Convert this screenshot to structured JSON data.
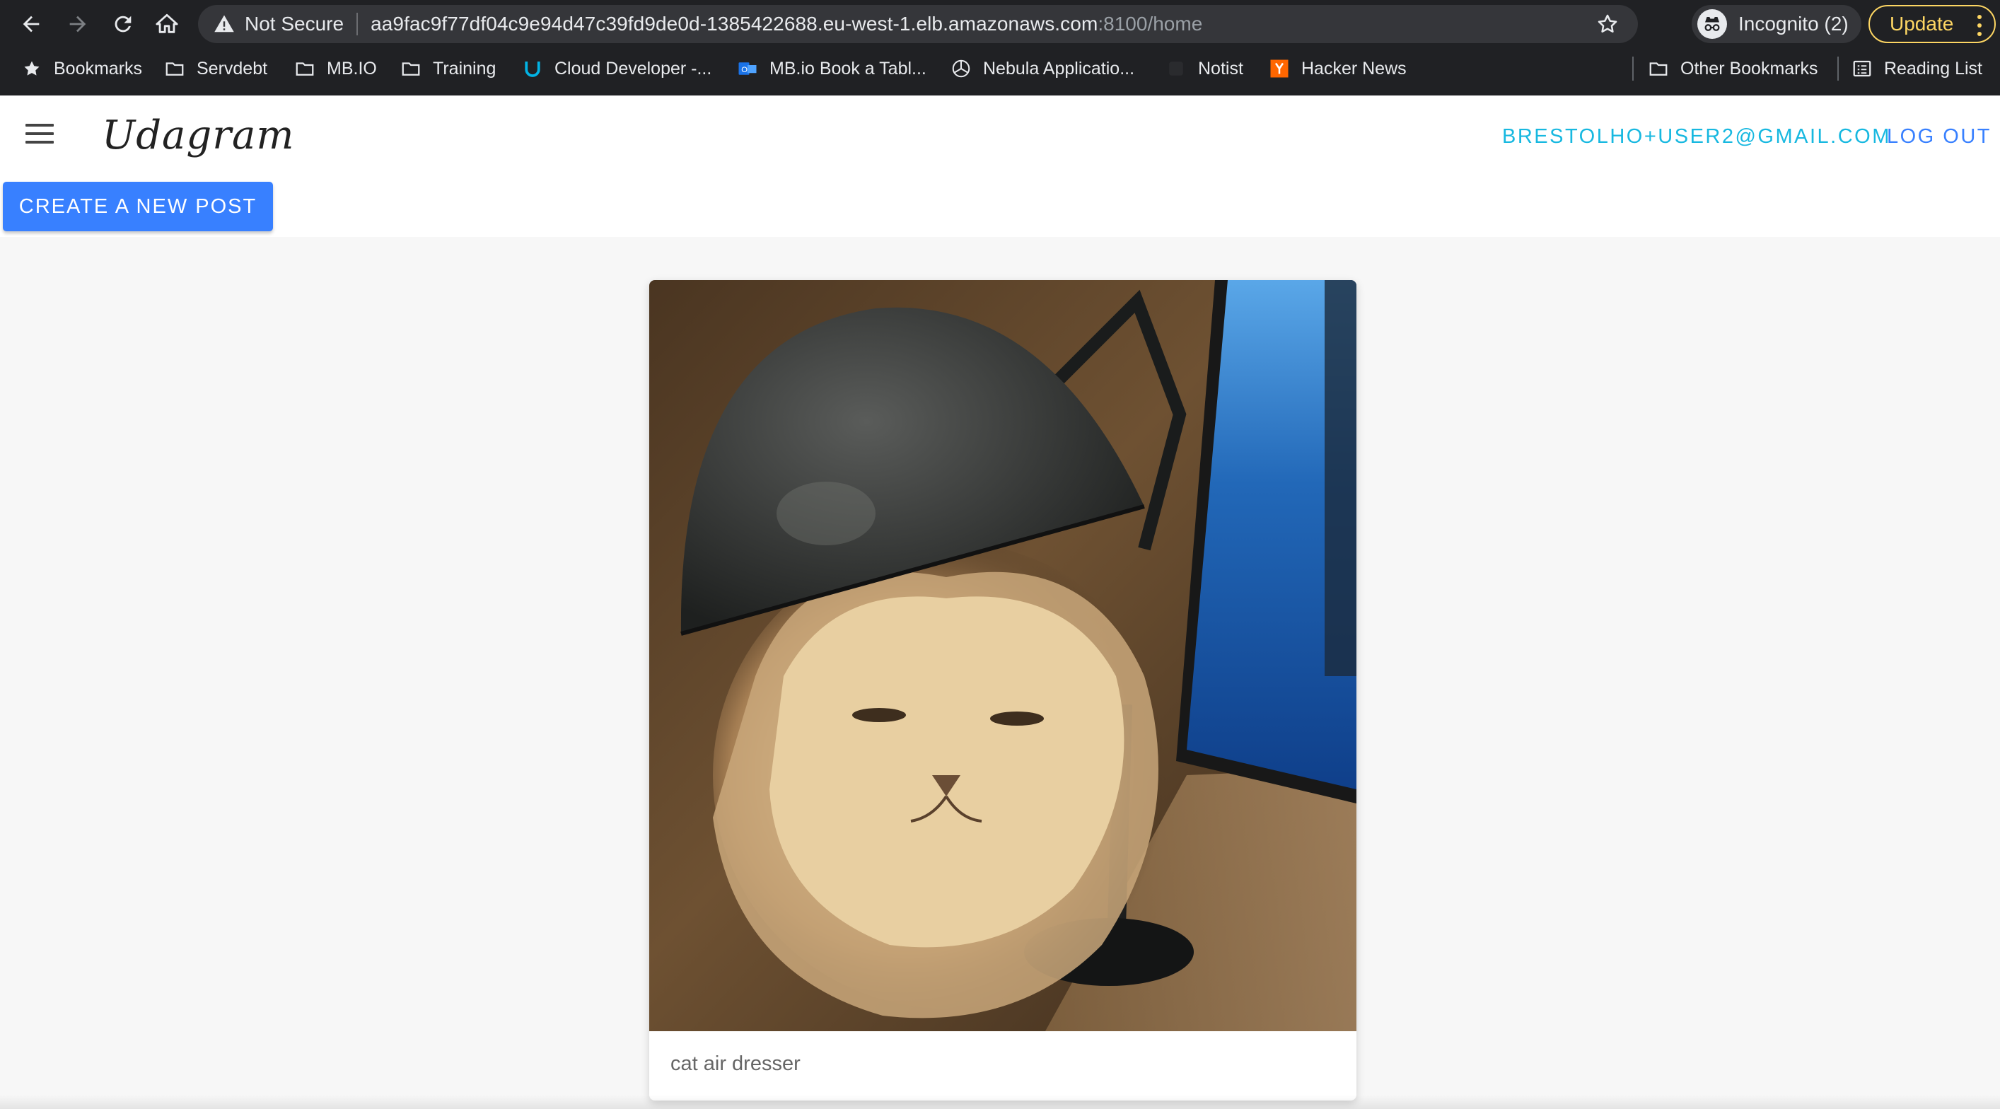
{
  "browser": {
    "security_label": "Not Secure",
    "url_host": "aa9fac9f77df04c9e94d47c39fd9de0d-1385422688.eu-west-1.elb.amazonaws.com",
    "url_rest": ":8100/home",
    "incognito_label": "Incognito (2)",
    "update_label": "Update",
    "bookmarks": {
      "b0": "Bookmarks",
      "b1": "Servdebt",
      "b2": "MB.IO",
      "b3": "Training",
      "b4": "Cloud Developer -...",
      "b5": "MB.io Book a Tabl...",
      "b6": "Nebula Applicatio...",
      "b7": "Notist",
      "b8": "Hacker News",
      "other": "Other Bookmarks",
      "reading": "Reading List"
    }
  },
  "app": {
    "brand": "Udagram",
    "user_email": "BRESTOLHO+USER2@GMAIL.COM",
    "logout_label": "LOG OUT",
    "create_post_label": "CREATE A NEW POST"
  },
  "feed": {
    "posts": [
      {
        "caption": "cat air dresser",
        "image": "cat-under-desk-lamp-photo"
      }
    ]
  },
  "colors": {
    "primary": "#3880ff",
    "email": "#17b8e0",
    "update": "#fdd663",
    "chrome_bg": "#202124"
  }
}
